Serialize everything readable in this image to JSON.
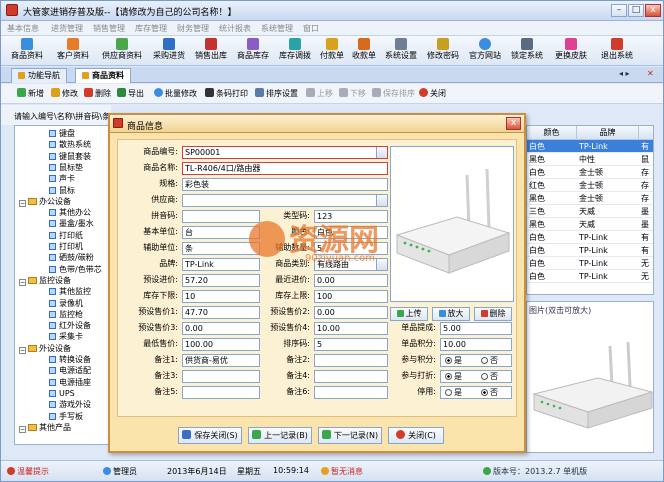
{
  "window": {
    "title": "大管家进销存普及版--【请修改为自己的公司名称！】",
    "minimize": "–",
    "maximize": "□",
    "close": "x"
  },
  "menu": [
    "基本信息",
    "进货管理",
    "销售管理",
    "库存管理",
    "财务管理",
    "统计报表",
    "系统管理",
    "窗口"
  ],
  "toolbar": [
    "商品资料",
    "客户资料",
    "供应商资料",
    "采购进货",
    "销售出库",
    "商品库存",
    "库存调拨",
    "付款单",
    "收款单",
    "系统设置",
    "修改密码",
    "官方网站",
    "锁定系统",
    "更换皮肤",
    "退出系统"
  ],
  "tabs": {
    "nav": "功能导航",
    "items": [
      "商品资料"
    ],
    "nav_arrows": "◂ ▸"
  },
  "actions": {
    "new": "新增",
    "edit": "修改",
    "delete": "删除",
    "export": "导出",
    "batch_edit": "批量修改",
    "barcode_print": "条码打印",
    "sort_setting": "排序设置",
    "move_up": "上移",
    "move_down": "下移",
    "save_sort": "保存排序",
    "close": "关闭"
  },
  "search": {
    "label": "请输入编号\\名称\\拼音码\\条"
  },
  "tree": [
    {
      "label": "键盘",
      "level": 2
    },
    {
      "label": "散热系统",
      "level": 2
    },
    {
      "label": "键鼠套装",
      "level": 2
    },
    {
      "label": "鼠标垫",
      "level": 2
    },
    {
      "label": "声卡",
      "level": 2
    },
    {
      "label": "鼠标",
      "level": 2
    },
    {
      "label": "办公设备",
      "level": 1
    },
    {
      "label": "其他办公",
      "level": 2
    },
    {
      "label": "墨盒/墨水",
      "level": 2
    },
    {
      "label": "打印纸",
      "level": 2
    },
    {
      "label": "打印机",
      "level": 2
    },
    {
      "label": "硒鼓/碳粉",
      "level": 2
    },
    {
      "label": "色带/色带芯",
      "level": 2
    },
    {
      "label": "监控设备",
      "level": 1
    },
    {
      "label": "其他监控",
      "level": 2
    },
    {
      "label": "录像机",
      "level": 2
    },
    {
      "label": "监控枪",
      "level": 2
    },
    {
      "label": "红外设备",
      "level": 2
    },
    {
      "label": "采集卡",
      "level": 2
    },
    {
      "label": "外设设备",
      "level": 1
    },
    {
      "label": "转换设备",
      "level": 2
    },
    {
      "label": "电源适配",
      "level": 2
    },
    {
      "label": "电源插座",
      "level": 2
    },
    {
      "label": "UPS",
      "level": 2
    },
    {
      "label": "游戏外设",
      "level": 2
    },
    {
      "label": "手写板",
      "level": 2
    },
    {
      "label": "其他产品",
      "level": 1
    }
  ],
  "grid": {
    "headers": [
      "颜色",
      "品牌"
    ],
    "rows": [
      [
        "白色",
        "TP-Link",
        "有"
      ],
      [
        "黑色",
        "中性",
        "鼠"
      ],
      [
        "白色",
        "金士顿",
        "存"
      ],
      [
        "红色",
        "金士顿",
        "存"
      ],
      [
        "黑色",
        "金士顿",
        "存"
      ],
      [
        "三色",
        "天威",
        "墨"
      ],
      [
        "黑色",
        "天威",
        "墨"
      ],
      [
        "白色",
        "TP-Link",
        "有"
      ],
      [
        "白色",
        "TP-Link",
        "有"
      ],
      [
        "白色",
        "TP-Link",
        "无"
      ],
      [
        "白色",
        "TP-Link",
        "无"
      ]
    ]
  },
  "photo": {
    "label": "图片(双击可放大)"
  },
  "dialog": {
    "title": "商品信息",
    "close": "x",
    "fields": {
      "code_label": "商品编号:",
      "code": "SP00001",
      "name_label": "商品名称:",
      "name": "TL-R406/4口/路由器",
      "spec_label": "规格:",
      "spec": "彩色装",
      "supplier_label": "供应商:",
      "supplier": "",
      "pinyin_label": "拼音码:",
      "pinyin": "",
      "type_label": "类型码:",
      "type": "123",
      "unit_label": "基本单位:",
      "unit": "台",
      "color_label": "颜色:",
      "color": "白色",
      "aux_unit_label": "辅助单位:",
      "aux_unit": "条",
      "aux_qty_label": "辅助数量:",
      "aux_qty": "5",
      "brand_label": "品牌:",
      "brand": "TP-Link",
      "category_label": "商品类别:",
      "category": "有线路由",
      "pre_buy_label": "预设进价:",
      "pre_buy": "57.20",
      "latest_buy_label": "最近进价:",
      "latest_buy": "0.00",
      "stock_low_label": "库存下限:",
      "stock_low": "10",
      "stock_high_label": "库存上限:",
      "stock_high": "100",
      "price1_label": "预设售价1:",
      "price1": "47.70",
      "price2_label": "预设售价2:",
      "price2": "0.00",
      "price3_label": "预设售价3:",
      "price3": "0.00",
      "price4_label": "预设售价4:",
      "price4": "10.00",
      "min_price_label": "最低售价:",
      "min_price": "100.00",
      "sort_code_label": "排序码:",
      "sort_code": "5",
      "note1_label": "备注1:",
      "note1": "供货商-易优",
      "note2_label": "备注2:",
      "note2": "",
      "note3_label": "备注3:",
      "note3": "",
      "note4_label": "备注4:",
      "note4": "",
      "note5_label": "备注5:",
      "note5": "",
      "note6_label": "备注6:",
      "note6": "",
      "commission_label": "单品提成:",
      "commission": "5.00",
      "points_label": "单品积分:",
      "points": "10.00",
      "join_points_label": "参与积分:",
      "join_discount_label": "参与打折:",
      "disabled_label": "停用:",
      "yes": "是",
      "no": "否"
    },
    "image_buttons": {
      "upload": "上传",
      "zoom": "放大",
      "delete": "删除"
    },
    "footer": {
      "save_close": "保存关闭(S)",
      "prev": "上一记录(B)",
      "next": "下一记录(N)",
      "close": "关闭(C)"
    }
  },
  "watermark": {
    "text": "资源网",
    "url": "90ziyuan.com"
  },
  "status": {
    "left": "温馨提示",
    "user": "管理员",
    "date": "2013年6月14日",
    "weekday": "星期五",
    "time": "10:59:14",
    "tip": "暂无消息",
    "version": "版本号：2013.2.7 单机版"
  }
}
